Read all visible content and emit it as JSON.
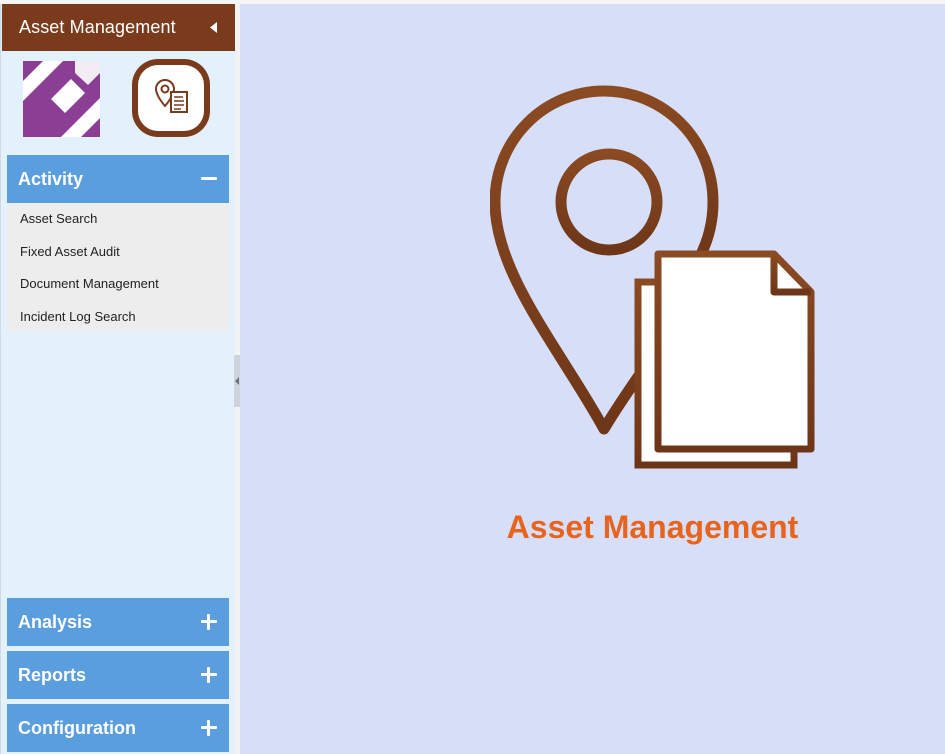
{
  "sidebar": {
    "title": "Asset Management",
    "sections": [
      {
        "label": "Activity",
        "expanded": true,
        "items": [
          "Asset Search",
          "Fixed Asset Audit",
          "Document Management",
          "Incident Log Search"
        ]
      },
      {
        "label": "Analysis",
        "expanded": false
      },
      {
        "label": "Reports",
        "expanded": false
      },
      {
        "label": "Configuration",
        "expanded": false
      }
    ]
  },
  "main": {
    "title": "Asset Management"
  },
  "icons": {
    "collapse": "triangle-left-icon",
    "section_expanded": "minus-icon",
    "section_collapsed": "plus-icon",
    "splitter": "chevron-left-icon",
    "hero": "location-pin-document-icon"
  },
  "colors": {
    "header_brown": "#7a3b1d",
    "section_blue": "#5a9ede",
    "sidebar_bg": "#e3f1fc",
    "main_bg": "#d7dff8",
    "title_orange": "#e8641c",
    "icon_brown": "#7b3f1e"
  }
}
